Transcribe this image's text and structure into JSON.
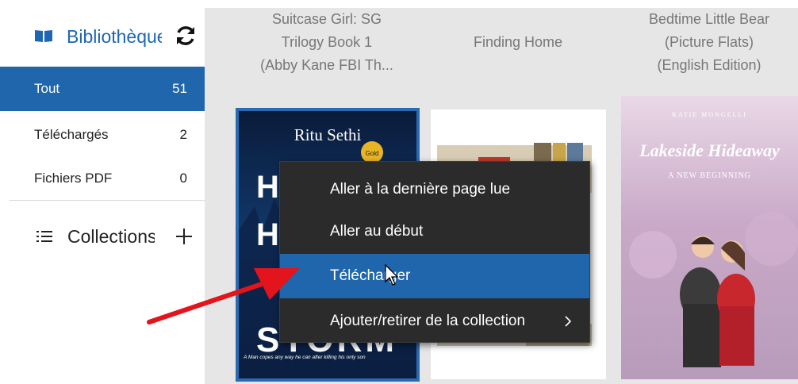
{
  "sidebar": {
    "title": "Bibliothèque",
    "items": [
      {
        "label": "Tout",
        "count": "51"
      },
      {
        "label": "Téléchargés",
        "count": "2"
      },
      {
        "label": "Fichiers PDF",
        "count": "0"
      }
    ],
    "collections_label": "Collections"
  },
  "books": [
    {
      "title_lines": [
        "Suitcase Girl: SG",
        "Trilogy Book 1",
        "(Abby Kane FBI Th..."
      ]
    },
    {
      "title_lines": [
        "Finding Home"
      ]
    },
    {
      "title_lines": [
        "Bedtime Little Bear",
        "(Picture Flats)",
        "(English Edition)"
      ]
    }
  ],
  "covers": {
    "book1": {
      "author": "Ritu Sethi",
      "big_letters": [
        "H",
        "H",
        "STORM"
      ],
      "tagline": "A Man copes any way he can after killing his only son"
    },
    "book3": {
      "author": "KATIE MONGELLI",
      "title": "Lakeside Hideaway",
      "subtitle": "A NEW BEGINNING"
    }
  },
  "context_menu": {
    "items": [
      {
        "label": "Aller à la dernière page lue"
      },
      {
        "label": "Aller au début"
      },
      {
        "label": "Télécharger"
      },
      {
        "label": "Ajouter/retirer de la collection"
      }
    ]
  },
  "colors": {
    "accent": "#1f66ad",
    "menu_bg": "#2b2b2b",
    "arrow": "#e3141b"
  }
}
